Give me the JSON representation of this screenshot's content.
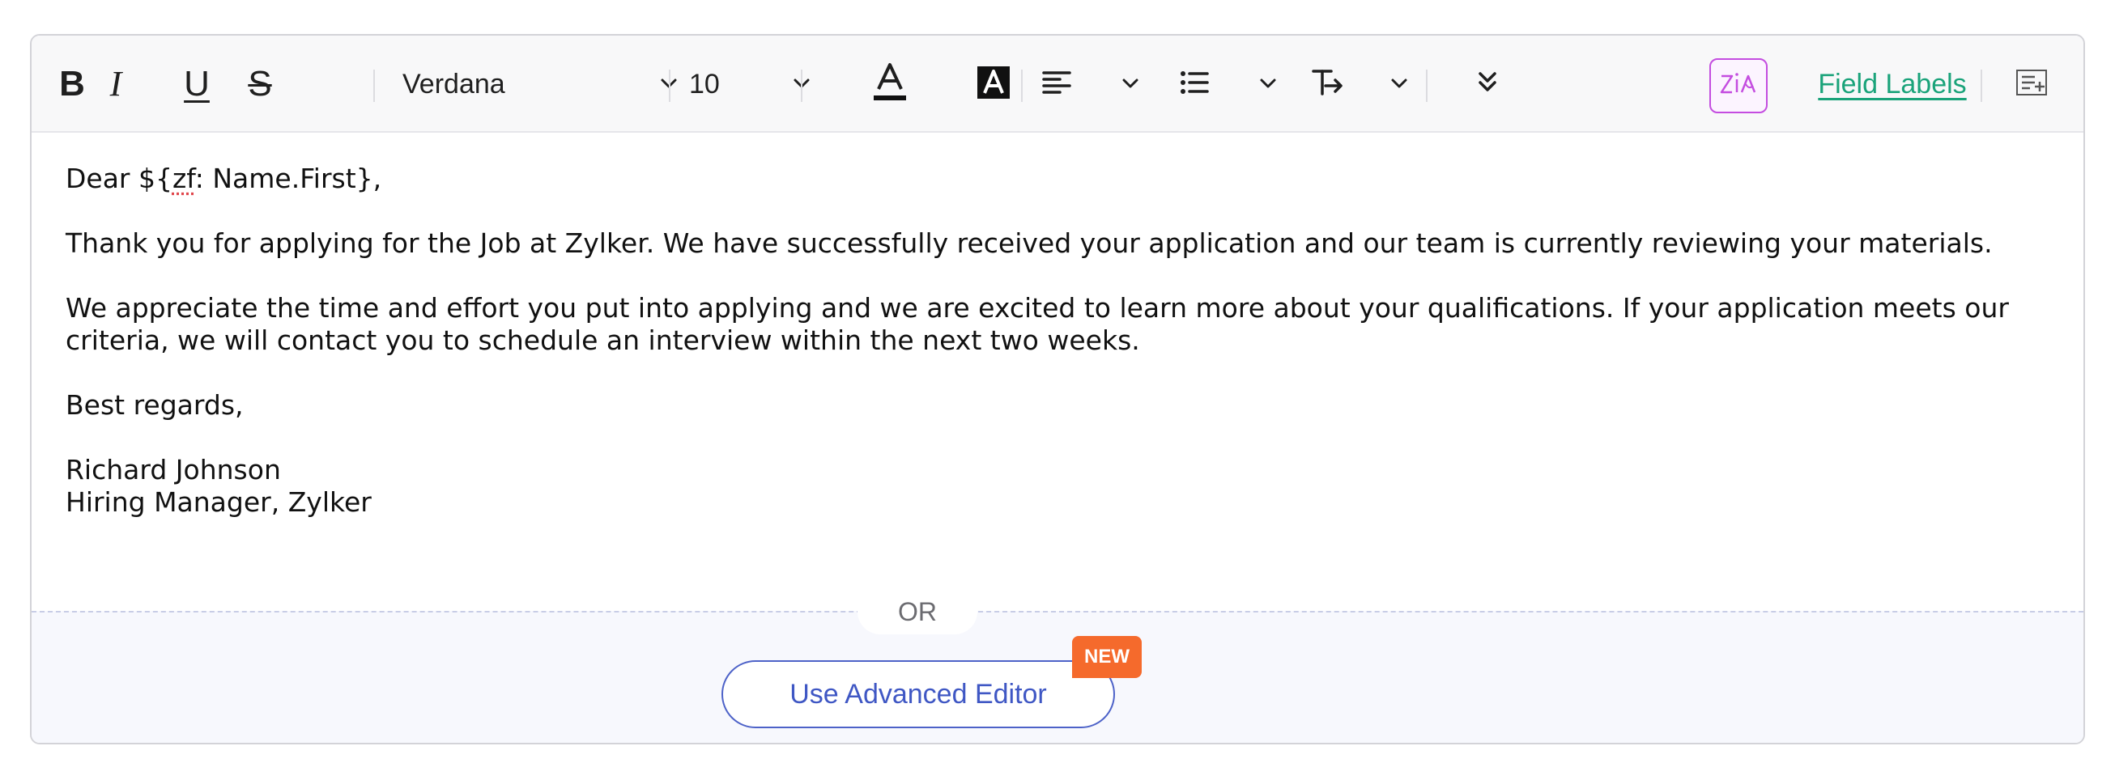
{
  "toolbar": {
    "bold_label": "B",
    "italic_label": "I",
    "underline_label": "U",
    "strike_label": "S",
    "font_family": "Verdana",
    "font_size": "10",
    "field_labels": "Field Labels"
  },
  "icons": {
    "text_color": "text-color-icon",
    "highlight": "background-color-icon",
    "align": "align-left-icon",
    "list": "bulleted-list-icon",
    "clear_format": "clear-formatting-icon",
    "more": "more-options-icon",
    "zia": "zia-ai-icon",
    "insert": "insert-field-icon"
  },
  "body": {
    "greeting": "Dear ${zf: Name.First},",
    "greeting_prefix": "Dear ${",
    "greeting_token": "zf",
    "greeting_suffix": ": Name.First},",
    "paragraph1": "Thank you for applying for the Job at Zylker. We have successfully received your application and our team is currently reviewing your materials.",
    "paragraph2": "We appreciate the time and effort you put into applying and we are excited to learn more about your qualifications. If your application meets our criteria, we will contact you to schedule an interview within the next two weeks.",
    "closing": "Best regards,",
    "signature_name": "Richard Johnson",
    "signature_title": "Hiring Manager, Zylker"
  },
  "footer": {
    "or_label": "OR",
    "advanced_editor_label": "Use Advanced Editor",
    "new_badge": "NEW"
  },
  "colors": {
    "accent_green": "#1aa37a",
    "accent_blue": "#3f57c4",
    "zia_purple": "#c44de0",
    "badge_orange": "#f56a2c"
  }
}
